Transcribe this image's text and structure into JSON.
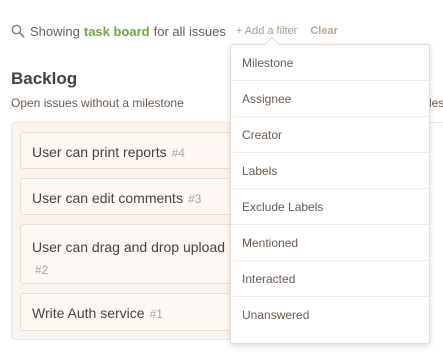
{
  "filter_bar": {
    "icon": "search-icon",
    "prefix": "Showing",
    "highlight": "task board",
    "suffix": "for all issues",
    "add_filter": "+ Add a filter",
    "clear": "Clear"
  },
  "backlog": {
    "title": "Backlog",
    "subtitle": "Open issues without a milestone",
    "issues": [
      {
        "title": "User can print reports",
        "number": "#4"
      },
      {
        "title": "User can edit comments",
        "number": "#3"
      },
      {
        "title": "User can drag and drop upload",
        "number": "#2"
      },
      {
        "title": "Write Auth service",
        "number": "#1"
      }
    ]
  },
  "right_fragment": "les",
  "filter_menu": {
    "items": [
      "Milestone",
      "Assignee",
      "Creator",
      "Labels",
      "Exclude Labels",
      "Mentioned",
      "Interacted",
      "Unanswered"
    ]
  },
  "colors": {
    "accent_green": "#6ea83a",
    "text_brown": "#5a4a3f",
    "panel_bg": "#fbf4ee"
  }
}
